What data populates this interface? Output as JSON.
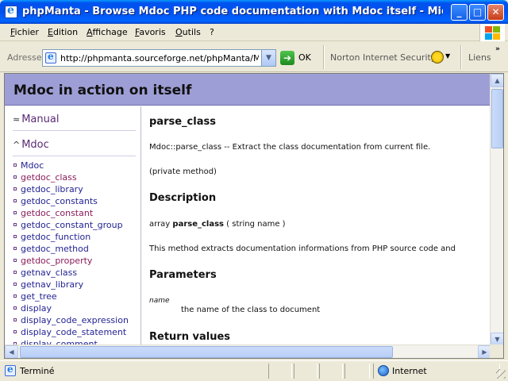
{
  "window": {
    "title": "phpManta - Browse Mdoc PHP code documentation with Mdoc itself - Microsoft Inter...",
    "min_glyph": "_",
    "max_glyph": "□",
    "close_glyph": "✕"
  },
  "menu": [
    "Fichier",
    "Edition",
    "Affichage",
    "Favoris",
    "Outils",
    "?"
  ],
  "address": {
    "label": "Adresse",
    "url": "http://phpmanta.sourceforge.net/phpManta/Mdoc/a",
    "go_label": "OK",
    "go_glyph": "➔",
    "toolbar_item": "Norton Internet Security",
    "links_label": "Liens",
    "links_chevron": "»"
  },
  "page": {
    "header_title": "Mdoc in action on itself",
    "sidebar": {
      "manual_label": "Manual",
      "manual_arrow": "≈",
      "mdoc_label": "Mdoc",
      "mdoc_arrow": "^",
      "items": [
        {
          "label": "Mdoc",
          "visited": false
        },
        {
          "label": "getdoc_class",
          "visited": true
        },
        {
          "label": "getdoc_library",
          "visited": false
        },
        {
          "label": "getdoc_constants",
          "visited": false
        },
        {
          "label": "getdoc_constant",
          "visited": true
        },
        {
          "label": "getdoc_constant_group",
          "visited": false
        },
        {
          "label": "getdoc_function",
          "visited": false
        },
        {
          "label": "getdoc_method",
          "visited": false
        },
        {
          "label": "getdoc_property",
          "visited": true
        },
        {
          "label": "getnav_class",
          "visited": false
        },
        {
          "label": "getnav_library",
          "visited": false
        },
        {
          "label": "get_tree",
          "visited": false
        },
        {
          "label": "display",
          "visited": false
        },
        {
          "label": "display_code_expression",
          "visited": false
        },
        {
          "label": "display_code_statement",
          "visited": false
        },
        {
          "label": "display_comment",
          "visited": false
        }
      ]
    },
    "main": {
      "func_name": "parse_class",
      "summary": "Mdoc::parse_class -- Extract the class documentation from current file.",
      "visibility": "(private method)",
      "description_heading": "Description",
      "signature_type": "array ",
      "signature_name": "parse_class",
      "signature_args": " ( string name )",
      "body": "This method extracts documentation informations from PHP source code and",
      "parameters_heading": "Parameters",
      "param_name": "name",
      "param_desc": "the name of the class to document",
      "return_heading": "Return values"
    }
  },
  "status": {
    "text": "Terminé",
    "zone": "Internet"
  },
  "colors": {
    "header_bg": "#9e9ed6",
    "link": "#232394",
    "visited_link": "#8a1c5a",
    "titlebar": "#0050ee"
  }
}
